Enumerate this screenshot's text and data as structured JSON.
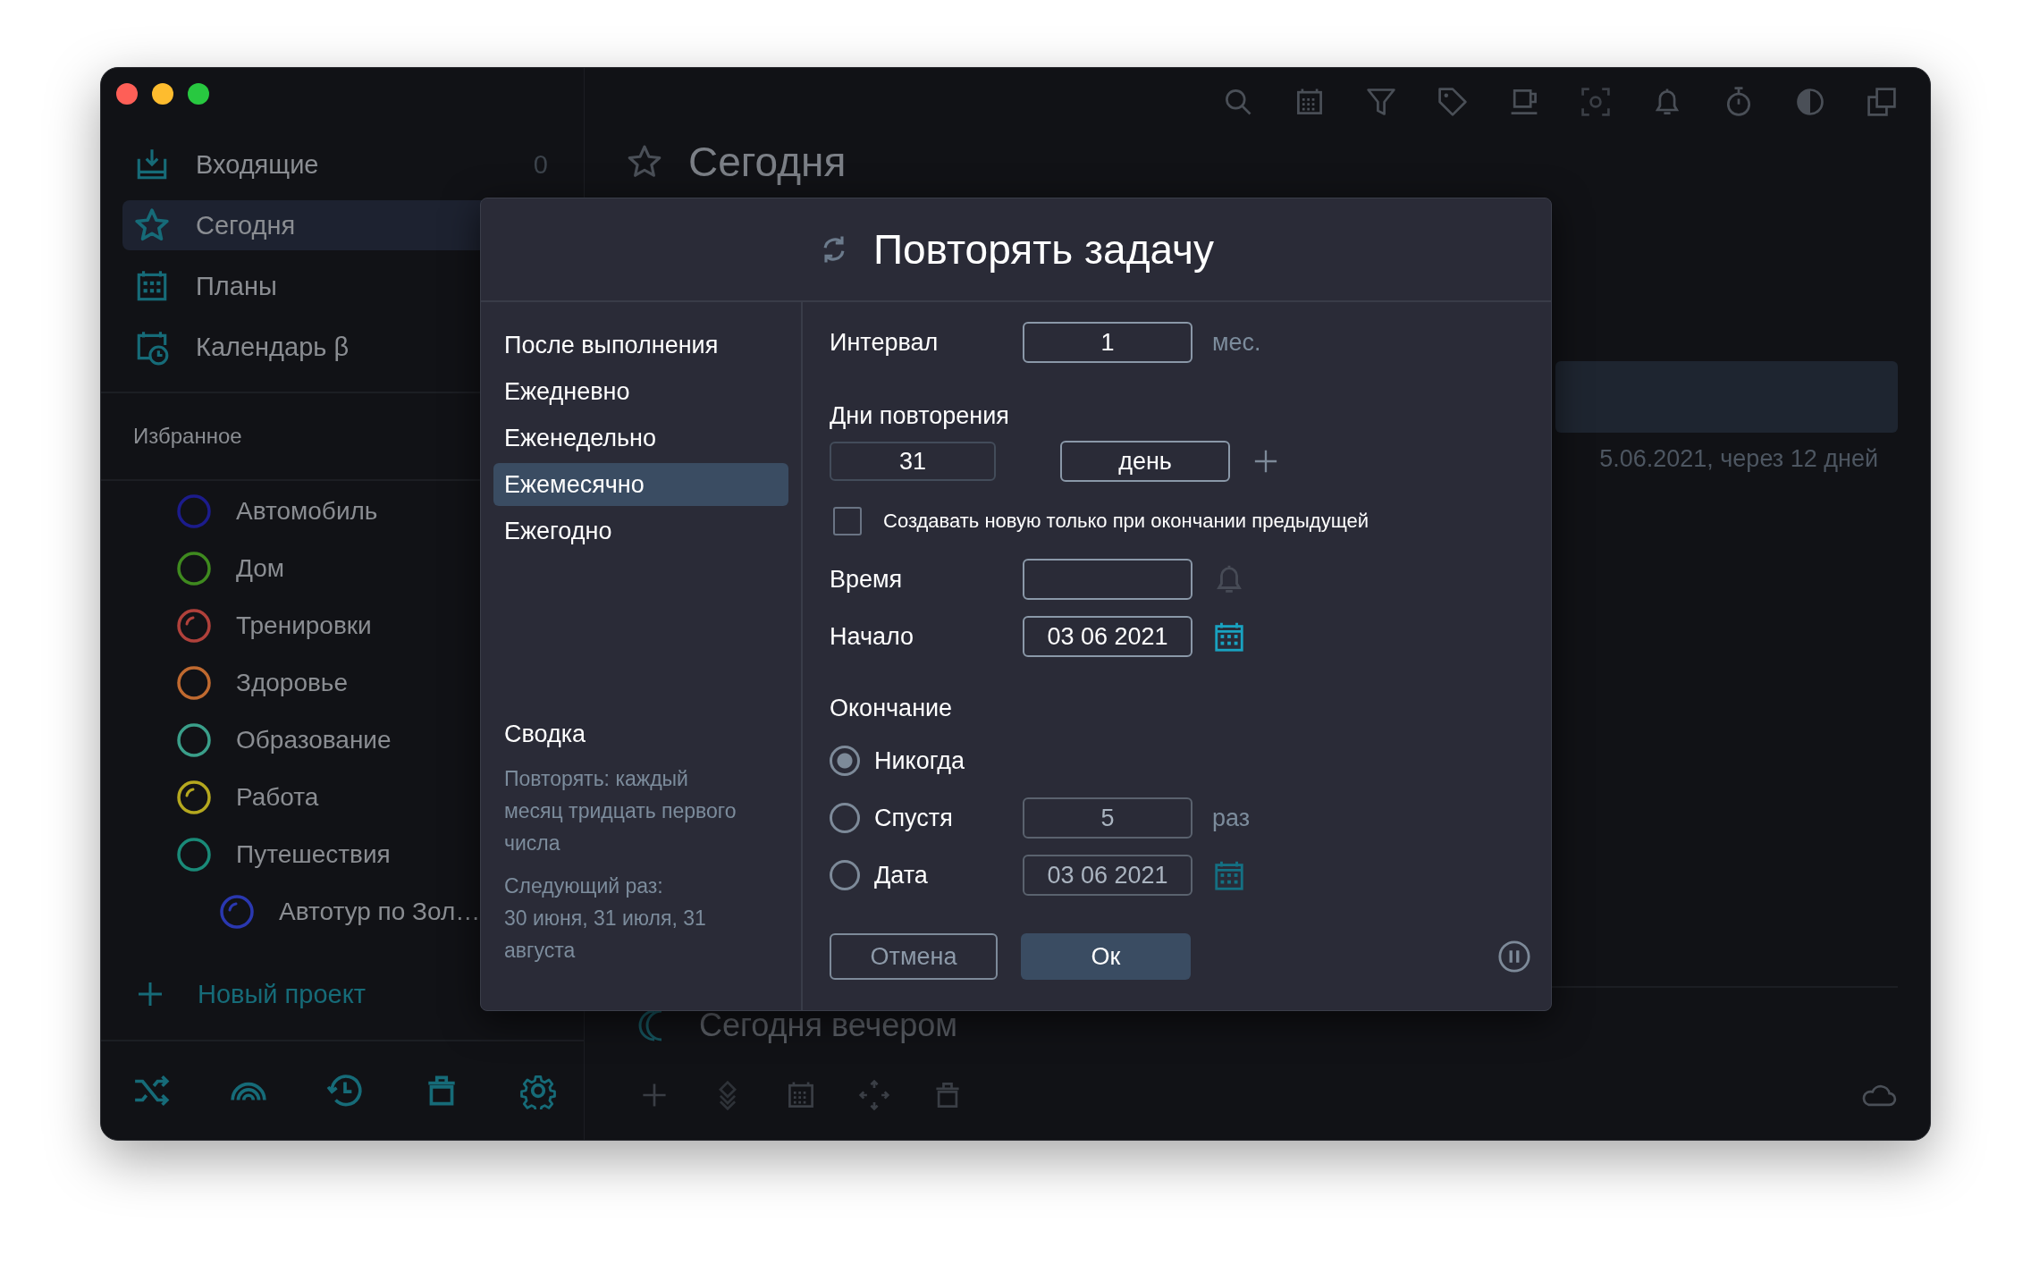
{
  "sidebar": {
    "nav": [
      {
        "label": "Входящие",
        "count": "0",
        "selected": false
      },
      {
        "label": "Сегодня",
        "selected": true
      },
      {
        "label": "Планы",
        "selected": false
      },
      {
        "label": "Календарь β",
        "selected": false
      }
    ],
    "favorites_title": "Избранное",
    "projects": [
      {
        "label": "Автомобиль",
        "color": "#1c1c8c",
        "started": false
      },
      {
        "label": "Дом",
        "color": "#3f8a1f",
        "started": false
      },
      {
        "label": "Тренировки",
        "color": "#b0413b",
        "started": true
      },
      {
        "label": "Здоровье",
        "color": "#c06a30",
        "started": false
      },
      {
        "label": "Образование",
        "color": "#3a9f8a",
        "started": false
      },
      {
        "label": "Работа",
        "color": "#b5a81f",
        "started": true
      },
      {
        "label": "Путешествия",
        "color": "#1a8a78",
        "started": false,
        "children": [
          {
            "label": "Автотур по Зол…",
            "color": "#2a38b0",
            "started": true
          }
        ]
      }
    ],
    "new_project": "Новый проект"
  },
  "main": {
    "title": "Сегодня",
    "task_meta": "5.06.2021, через 12 дней",
    "evening": "Сегодня вечером"
  },
  "dialog": {
    "title": "Повторять задачу",
    "options": [
      {
        "label": "После выполнения",
        "selected": false
      },
      {
        "label": "Ежедневно",
        "selected": false
      },
      {
        "label": "Еженедельно",
        "selected": false
      },
      {
        "label": "Ежемесячно",
        "selected": true
      },
      {
        "label": "Ежегодно",
        "selected": false
      }
    ],
    "summary_title": "Сводка",
    "summary": "Повторять: каждый месяц тридцать первого числа",
    "next_label": "Следующий раз:",
    "next_dates": "30 июня, 31 июля, 31 августа",
    "interval": {
      "label": "Интервал",
      "value": "1",
      "unit": "мес."
    },
    "days": {
      "label": "Дни повторения",
      "day": "31",
      "unit": "день"
    },
    "only_after": {
      "label": "Создавать новую только при окончании предыдущей",
      "checked": false
    },
    "time": {
      "label": "Время"
    },
    "start": {
      "label": "Начало",
      "value": "03 06 2021"
    },
    "end": {
      "label": "Окончание",
      "choices": [
        {
          "label": "Никогда",
          "selected": true
        },
        {
          "label": "Спустя",
          "selected": false,
          "value": "5",
          "unit": "раз",
          "disabled": true
        },
        {
          "label": "Дата",
          "selected": false,
          "value": "03 06 2021",
          "disabled": true
        }
      ]
    },
    "cancel": "Отмена",
    "ok": "Ок"
  }
}
